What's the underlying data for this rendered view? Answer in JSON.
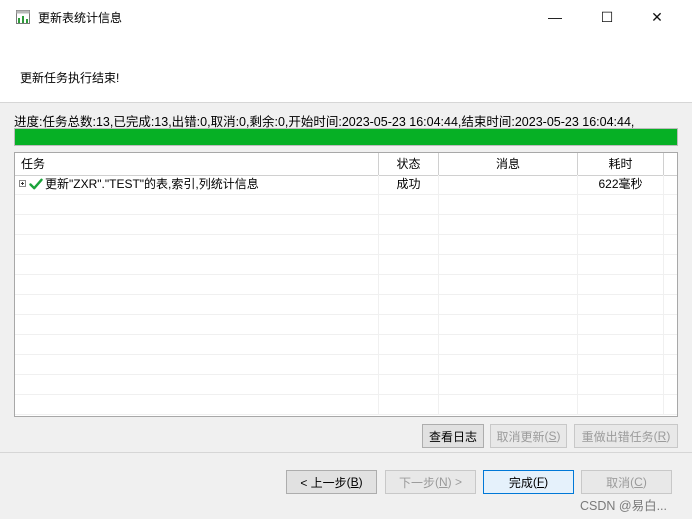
{
  "window": {
    "title": "更新表统计信息",
    "controls": {
      "minimize": "—",
      "maximize": "☐",
      "close": "✕"
    }
  },
  "header": {
    "message": "更新任务执行结束!"
  },
  "progress": {
    "text": "进度:任务总数:13,已完成:13,出错:0,取消:0,剩余:0,开始时间:2023-05-23 16:04:44,结束时间:2023-05-23 16:04:44,",
    "percent": 100,
    "color": "#06b025"
  },
  "table": {
    "columns": [
      "任务",
      "状态",
      "消息",
      "耗时"
    ],
    "rows": [
      {
        "task": "更新\"ZXR\".\"TEST\"的表,索引,列统计信息",
        "status": "成功",
        "message": "",
        "elapsed": "622毫秒"
      }
    ]
  },
  "actions": {
    "view_log": "查看日志",
    "cancel_update": "取消更新",
    "cancel_update_key": "S",
    "redo_failed": "重做出错任务",
    "redo_failed_key": "R"
  },
  "nav": {
    "prev": "< 上一步",
    "prev_key": "B",
    "next": "下一步",
    "next_key": "N",
    "next_suffix": " >",
    "finish": "完成",
    "finish_key": "F",
    "cancel": "取消",
    "cancel_key": "C"
  },
  "watermark": "CSDN @易白..."
}
